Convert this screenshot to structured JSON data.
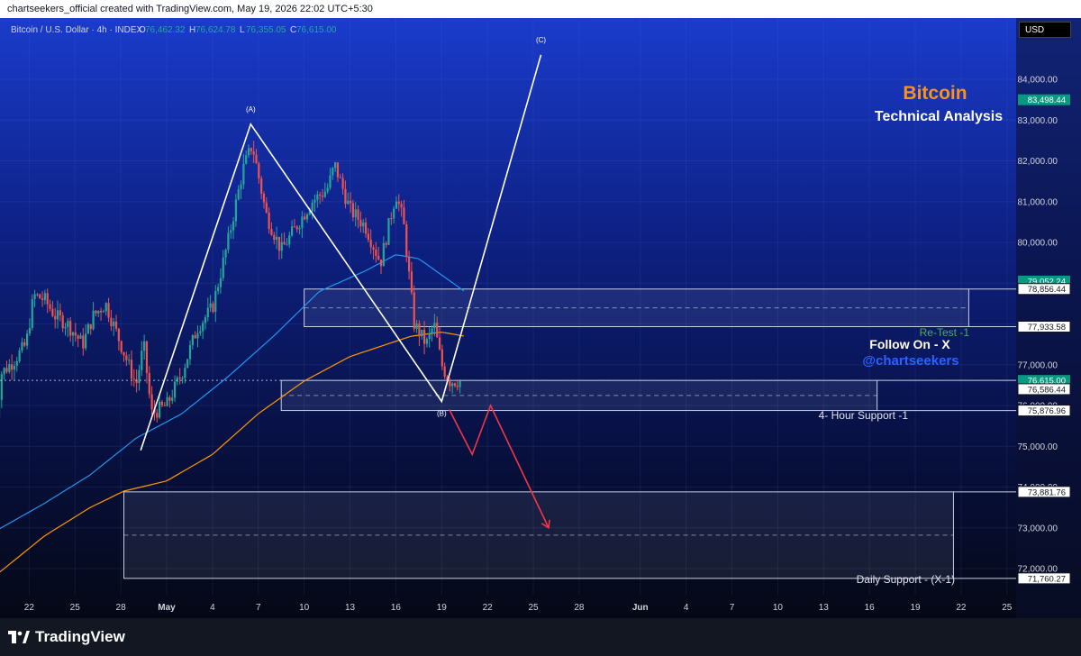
{
  "header": {
    "caption": "chartseekers_official created with TradingView.com, May 19, 2026 22:02 UTC+5:30",
    "symbol": "Bitcoin / U.S. Dollar · 4h · INDEX",
    "ohlc": [
      {
        "k": "O",
        "v": "76,462.32"
      },
      {
        "k": "H",
        "v": "76,624.78"
      },
      {
        "k": "L",
        "v": "76,355.05"
      },
      {
        "k": "C",
        "v": "76,615.00"
      }
    ]
  },
  "currency_button": "USD",
  "footer": {
    "brand": "TradingView"
  },
  "colors": {
    "up": "#26a69a",
    "down": "#ef5350",
    "ema_fast": "#2196f3",
    "ema_slow": "#ff9800",
    "wave": "#ffffff",
    "projection": "#f23645",
    "title": "#f7931a",
    "handle": "#2962ff",
    "retest": "#4caf50"
  },
  "chart_data": {
    "type": "candlestick",
    "y_axis": {
      "range": [
        71000,
        85000
      ],
      "ticks": [
        72000,
        73000,
        74000,
        75000,
        76000,
        77000,
        78000,
        79000,
        80000,
        81000,
        82000,
        83000,
        84000
      ],
      "tick_labels": [
        "72,000.00",
        "73,000.00",
        "74,000.00",
        "75,000.00",
        "76,000.00",
        "77,000.00",
        "78,000.00",
        "79,000.00",
        "80,000.00",
        "81,000.00",
        "82,000.00",
        "83,000.00",
        "84,000.00"
      ]
    },
    "x_axis": {
      "labels": [
        "22",
        "25",
        "28",
        "May",
        "4",
        "7",
        "10",
        "13",
        "16",
        "19",
        "22",
        "25",
        "28",
        "Jun",
        "4",
        "7",
        "10",
        "13",
        "16",
        "19",
        "22",
        "25"
      ],
      "label_day_index": [
        -9,
        -6,
        -3,
        0,
        3,
        6,
        9,
        12,
        15,
        18,
        21,
        24,
        27,
        31,
        34,
        37,
        40,
        43,
        46,
        49,
        52,
        55
      ],
      "bold": [
        "May",
        "Jun"
      ],
      "first_day_index": -11.3,
      "last_day_index": 55.5
    },
    "candle_anchors": [
      {
        "d": -11.3,
        "p": 75300
      },
      {
        "d": -10.8,
        "p": 76800
      },
      {
        "d": -10.0,
        "p": 77100
      },
      {
        "d": -9.2,
        "p": 77500
      },
      {
        "d": -8.7,
        "p": 78700
      },
      {
        "d": -8.0,
        "p": 78600
      },
      {
        "d": -7.3,
        "p": 78200
      },
      {
        "d": -6.5,
        "p": 78000
      },
      {
        "d": -5.5,
        "p": 77500
      },
      {
        "d": -4.8,
        "p": 78200
      },
      {
        "d": -4.0,
        "p": 78500
      },
      {
        "d": -3.5,
        "p": 78000
      },
      {
        "d": -2.7,
        "p": 77200
      },
      {
        "d": -2.0,
        "p": 76500
      },
      {
        "d": -1.5,
        "p": 77500
      },
      {
        "d": -1.0,
        "p": 75800
      },
      {
        "d": 0.0,
        "p": 76000
      },
      {
        "d": 1.0,
        "p": 76800
      },
      {
        "d": 2.0,
        "p": 77900
      },
      {
        "d": 3.0,
        "p": 78400
      },
      {
        "d": 4.0,
        "p": 80000
      },
      {
        "d": 5.0,
        "p": 81800
      },
      {
        "d": 5.6,
        "p": 82400
      },
      {
        "d": 6.5,
        "p": 80700
      },
      {
        "d": 7.5,
        "p": 79800
      },
      {
        "d": 8.5,
        "p": 80400
      },
      {
        "d": 9.5,
        "p": 81000
      },
      {
        "d": 10.5,
        "p": 81300
      },
      {
        "d": 11.0,
        "p": 81900
      },
      {
        "d": 12.0,
        "p": 80800
      },
      {
        "d": 13.0,
        "p": 80400
      },
      {
        "d": 14.0,
        "p": 79500
      },
      {
        "d": 15.0,
        "p": 81200
      },
      {
        "d": 15.5,
        "p": 80500
      },
      {
        "d": 16.2,
        "p": 78000
      },
      {
        "d": 17.0,
        "p": 77500
      },
      {
        "d": 17.5,
        "p": 78000
      },
      {
        "d": 18.0,
        "p": 77000
      },
      {
        "d": 18.5,
        "p": 76600
      },
      {
        "d": 19.3,
        "p": 76615
      }
    ],
    "price_tags": [
      {
        "label": "83,498.44",
        "value": 83498.44,
        "style": "green"
      },
      {
        "label": "79,052.24",
        "value": 79052.24,
        "style": "green"
      },
      {
        "label": "78,856.44",
        "value": 78856.44,
        "style": "outline"
      },
      {
        "label": "77,933.58",
        "value": 77933.58,
        "style": "outline"
      },
      {
        "label": "76,615.00",
        "value": 76615.0,
        "style": "green",
        "sub": "03:27:53"
      },
      {
        "label": "76,586.44",
        "value": 76400,
        "style": "outline"
      },
      {
        "label": "75,876.96",
        "value": 75876.96,
        "style": "outline"
      },
      {
        "label": "73,881.76",
        "value": 73881.76,
        "style": "outline"
      },
      {
        "label": "71,760.27",
        "value": 71760.27,
        "style": "outline"
      }
    ],
    "zones": [
      {
        "d0": 9.0,
        "d1": 52.5,
        "top": 78856.44,
        "bottom": 77933.58,
        "tag": "Re-Test -1"
      },
      {
        "d0": 7.5,
        "d1": 46.5,
        "top": 76615.0,
        "bottom": 75876.96,
        "tag": "4- Hour Support -1"
      },
      {
        "d0": -2.8,
        "d1": 51.5,
        "top": 73881.76,
        "bottom": 71760.27,
        "tag": "Daily Support  - (X-1)"
      }
    ],
    "wave_points": [
      {
        "d": -1.7,
        "p": 74900
      },
      {
        "d": 5.5,
        "p": 82900,
        "label": "(A)"
      },
      {
        "d": 18.0,
        "p": 76100,
        "label": "(B)"
      },
      {
        "d": 24.5,
        "p": 84600,
        "label": "(C)"
      }
    ],
    "projection": [
      {
        "d": 18.5,
        "p": 75900
      },
      {
        "d": 20.0,
        "p": 74800
      },
      {
        "d": 21.2,
        "p": 76000
      },
      {
        "d": 25.0,
        "p": 73000
      }
    ],
    "ema_fast": [
      {
        "d": -11.3,
        "p": 72900
      },
      {
        "d": -8.0,
        "p": 73600
      },
      {
        "d": -5.0,
        "p": 74300
      },
      {
        "d": -2.0,
        "p": 75200
      },
      {
        "d": 1.0,
        "p": 75800
      },
      {
        "d": 4.0,
        "p": 76700
      },
      {
        "d": 7.0,
        "p": 77700
      },
      {
        "d": 10.0,
        "p": 78800
      },
      {
        "d": 13.0,
        "p": 79300
      },
      {
        "d": 15.0,
        "p": 79700
      },
      {
        "d": 16.5,
        "p": 79600
      },
      {
        "d": 18.0,
        "p": 79200
      },
      {
        "d": 19.5,
        "p": 78800
      }
    ],
    "ema_slow": [
      {
        "d": -11.3,
        "p": 71800
      },
      {
        "d": -8.0,
        "p": 72800
      },
      {
        "d": -5.0,
        "p": 73500
      },
      {
        "d": -2.8,
        "p": 73900
      },
      {
        "d": 0.0,
        "p": 74150
      },
      {
        "d": 3.0,
        "p": 74800
      },
      {
        "d": 6.0,
        "p": 75800
      },
      {
        "d": 9.0,
        "p": 76600
      },
      {
        "d": 12.0,
        "p": 77200
      },
      {
        "d": 14.0,
        "p": 77450
      },
      {
        "d": 16.0,
        "p": 77700
      },
      {
        "d": 18.0,
        "p": 77800
      },
      {
        "d": 19.5,
        "p": 77700
      }
    ]
  },
  "annotations": {
    "title": "Bitcoin",
    "subtitle": "Technical Analysis",
    "follow": "Follow On - X",
    "handle": "@chartseekers",
    "retest": "Re-Test -1",
    "hour_support": "4- Hour Support -1",
    "daily_support": "Daily Support  - (X-1)"
  }
}
